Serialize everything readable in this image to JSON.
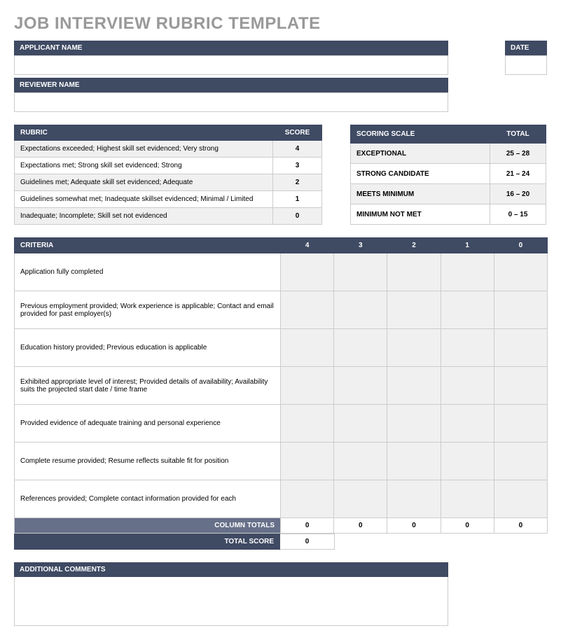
{
  "title": "JOB INTERVIEW RUBRIC TEMPLATE",
  "header": {
    "applicant_label": "APPLICANT NAME",
    "applicant_value": "",
    "date_label": "DATE",
    "date_value": "",
    "reviewer_label": "REVIEWER NAME",
    "reviewer_value": ""
  },
  "rubric": {
    "col_rubric": "RUBRIC",
    "col_score": "SCORE",
    "rows": [
      {
        "desc": "Expectations exceeded; Highest skill set evidenced; Very strong",
        "score": "4"
      },
      {
        "desc": "Expectations met; Strong skill set evidenced; Strong",
        "score": "3"
      },
      {
        "desc": "Guidelines met; Adequate skill set evidenced; Adequate",
        "score": "2"
      },
      {
        "desc": "Guidelines somewhat met; Inadequate skillset evidenced; Minimal / Limited",
        "score": "1"
      },
      {
        "desc": "Inadequate; Incomplete; Skill set not evidenced",
        "score": "0"
      }
    ]
  },
  "scoring": {
    "col_scale": "SCORING SCALE",
    "col_total": "TOTAL",
    "rows": [
      {
        "label": "EXCEPTIONAL",
        "range": "25 – 28"
      },
      {
        "label": "STRONG CANDIDATE",
        "range": "21 – 24"
      },
      {
        "label": "MEETS MINIMUM",
        "range": "16 – 20"
      },
      {
        "label": "MINIMUM NOT MET",
        "range": "0 – 15"
      }
    ]
  },
  "criteria": {
    "col_criteria": "CRITERIA",
    "col_4": "4",
    "col_3": "3",
    "col_2": "2",
    "col_1": "1",
    "col_0": "0",
    "rows": [
      "Application fully completed",
      "Previous employment provided; Work experience is applicable; Contact and email provided for past employer(s)",
      "Education history provided; Previous education is applicable",
      "Exhibited appropriate level of interest; Provided details of availability; Availability suits the projected start date / time frame",
      "Provided evidence of adequate training and personal experience",
      "Complete resume provided; Resume reflects suitable fit for position",
      "References provided; Complete contact information provided for each"
    ],
    "column_totals_label": "COLUMN TOTALS",
    "column_totals": [
      "0",
      "0",
      "0",
      "0",
      "0"
    ],
    "total_score_label": "TOTAL SCORE",
    "total_score": "0"
  },
  "comments_label": "ADDITIONAL COMMENTS"
}
